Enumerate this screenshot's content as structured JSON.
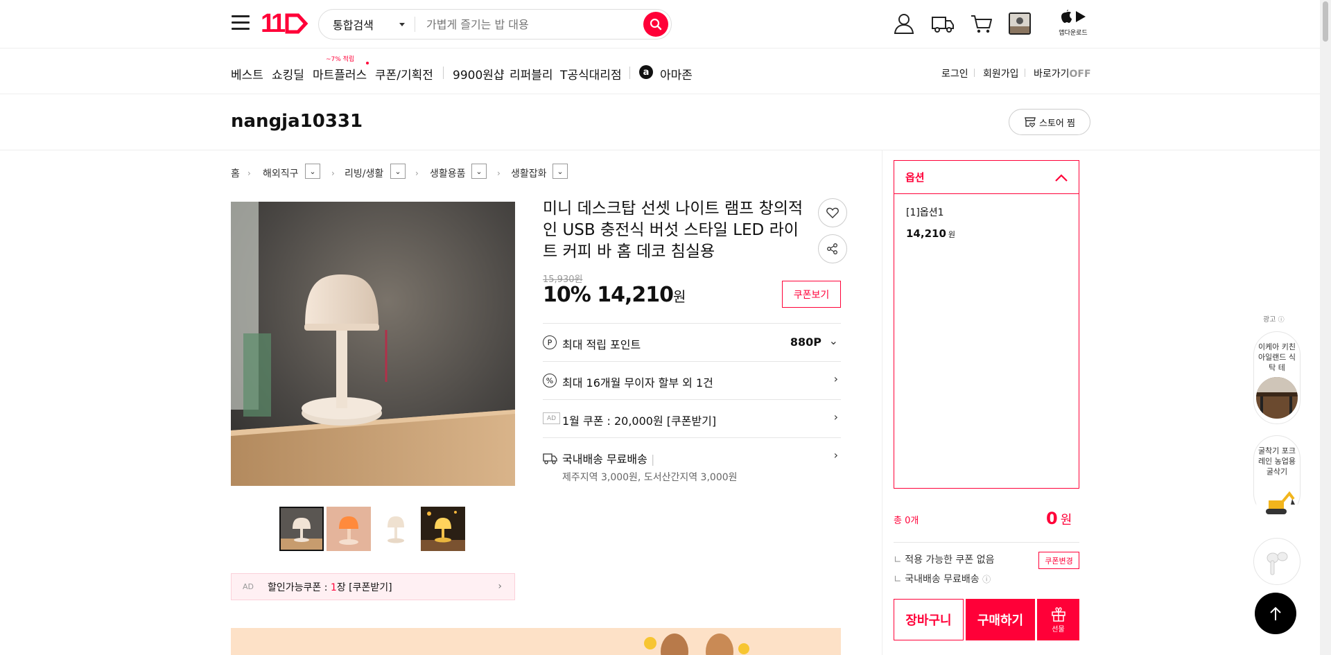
{
  "header": {
    "logo_text": "11",
    "search": {
      "type_label": "통합검색",
      "placeholder": "가볍게 즐기는 밥 대용"
    },
    "app_download_label": "앱다운로드"
  },
  "nav": {
    "items": [
      {
        "label": "베스트"
      },
      {
        "label": "쇼킹딜"
      },
      {
        "label": "마트플러스",
        "badge": "~7% 적립"
      },
      {
        "label": "쿠폰/기획전"
      },
      {
        "label": "9900원샵"
      },
      {
        "label": "리퍼블리"
      },
      {
        "label": "T공식대리점"
      },
      {
        "label": "아마존"
      }
    ],
    "amazon_icon_letter": "a",
    "util": {
      "login": "로그인",
      "signup": "회원가입",
      "shortcut": "바로가기",
      "shortcut_state": "OFF"
    }
  },
  "seller": {
    "name": "nangja10331",
    "store_button": "스토어 찜"
  },
  "breadcrumb": [
    "홈",
    "해외직구",
    "리빙/생활",
    "생활용품",
    "생활잡화"
  ],
  "product": {
    "title": "미니 데스크탑 선셋 나이트 램프 창의적인 USB 충전식 버섯 스타일 LED 라이트 커피 바 홈 데코 침실용",
    "original_price": "15,930원",
    "discount": "10%",
    "price": "14,210",
    "price_unit": "원",
    "coupon_view_label": "쿠폰보기",
    "points": {
      "label": "최대 적립 포인트",
      "value": "880P",
      "icon": "P"
    },
    "installment": {
      "label": "최대 16개월 무이자 할부 외 1건",
      "icon": "%"
    },
    "coupon_ad": {
      "tag": "AD",
      "label": "1월 쿠폰 : 20,000원 [쿠폰받기]"
    },
    "shipping": {
      "label": "국내배송 무료배송",
      "sub": "제주지역 3,000원, 도서산간지역 3,000원"
    },
    "discount_coupon_bar": {
      "tag": "AD",
      "label": "할인가능쿠폰 : ",
      "count": "1",
      "suffix": "장 [쿠폰받기]"
    }
  },
  "option_panel": {
    "header": "옵션",
    "item_name": "[1]옵션1",
    "item_price": "14,210",
    "item_price_unit": "원",
    "total_label": "총 0개",
    "total_value": "0",
    "total_unit": "원",
    "no_coupon": "적용 가능한 쿠폰 없음",
    "free_ship": "국내배송 무료배송",
    "coupon_change": "쿠폰변경",
    "cart": "장바구니",
    "buy": "구매하기",
    "gift": "선물"
  },
  "side_ads": {
    "label": "광고",
    "items": [
      {
        "text": "이케아 키친 아일랜드 식탁 테"
      },
      {
        "text": "굴착기 포크레인 농업용굴삭기"
      },
      {
        "text": ""
      }
    ]
  },
  "colors": {
    "brand": "#ff0038",
    "text": "#111111",
    "muted": "#999999"
  }
}
